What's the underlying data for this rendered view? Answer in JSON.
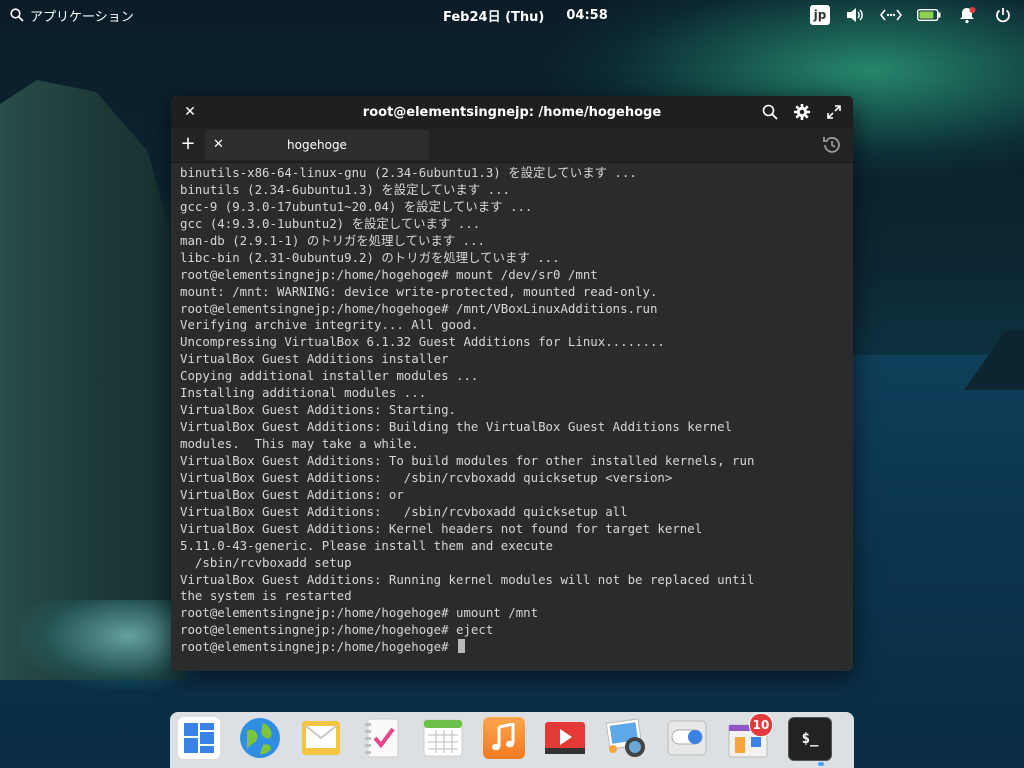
{
  "panel": {
    "applications_label": "アプリケーション",
    "date": "Feb24日 (Thu)",
    "time": "04:58",
    "keyboard_layout": "jp",
    "icons": [
      "volume-icon",
      "network-icon",
      "battery-icon",
      "notification-icon",
      "power-icon"
    ],
    "battery_level": 0.85
  },
  "terminal": {
    "title": "root@elementsingnejp: /home/hogehoge",
    "tab_label": "hogehoge",
    "lines": [
      "binutils-x86-64-linux-gnu (2.34-6ubuntu1.3) を設定しています ...",
      "binutils (2.34-6ubuntu1.3) を設定しています ...",
      "gcc-9 (9.3.0-17ubuntu1~20.04) を設定しています ...",
      "gcc (4:9.3.0-1ubuntu2) を設定しています ...",
      "man-db (2.9.1-1) のトリガを処理しています ...",
      "libc-bin (2.31-0ubuntu9.2) のトリガを処理しています ...",
      "root@elementsingnejp:/home/hogehoge# mount /dev/sr0 /mnt",
      "mount: /mnt: WARNING: device write-protected, mounted read-only.",
      "root@elementsingnejp:/home/hogehoge# /mnt/VBoxLinuxAdditions.run",
      "Verifying archive integrity... All good.",
      "Uncompressing VirtualBox 6.1.32 Guest Additions for Linux........",
      "VirtualBox Guest Additions installer",
      "Copying additional installer modules ...",
      "Installing additional modules ...",
      "VirtualBox Guest Additions: Starting.",
      "VirtualBox Guest Additions: Building the VirtualBox Guest Additions kernel",
      "modules.  This may take a while.",
      "VirtualBox Guest Additions: To build modules for other installed kernels, run",
      "VirtualBox Guest Additions:   /sbin/rcvboxadd quicksetup <version>",
      "VirtualBox Guest Additions: or",
      "VirtualBox Guest Additions:   /sbin/rcvboxadd quicksetup all",
      "VirtualBox Guest Additions: Kernel headers not found for target kernel",
      "5.11.0-43-generic. Please install them and execute",
      "  /sbin/rcvboxadd setup",
      "VirtualBox Guest Additions: Running kernel modules will not be replaced until",
      "the system is restarted",
      "root@elementsingnejp:/home/hogehoge# umount /mnt",
      "root@elementsingnejp:/home/hogehoge# eject"
    ],
    "prompt": "root@elementsingnejp:/home/hogehoge# "
  },
  "dock": {
    "apps": [
      {
        "name": "multitasking-view-icon"
      },
      {
        "name": "web-browser-icon"
      },
      {
        "name": "mail-icon"
      },
      {
        "name": "tasks-icon"
      },
      {
        "name": "calendar-icon"
      },
      {
        "name": "music-icon"
      },
      {
        "name": "videos-icon"
      },
      {
        "name": "photos-icon"
      },
      {
        "name": "settings-icon"
      },
      {
        "name": "appcenter-icon",
        "badge": "10"
      },
      {
        "name": "terminal-icon",
        "label": "$_"
      }
    ]
  }
}
